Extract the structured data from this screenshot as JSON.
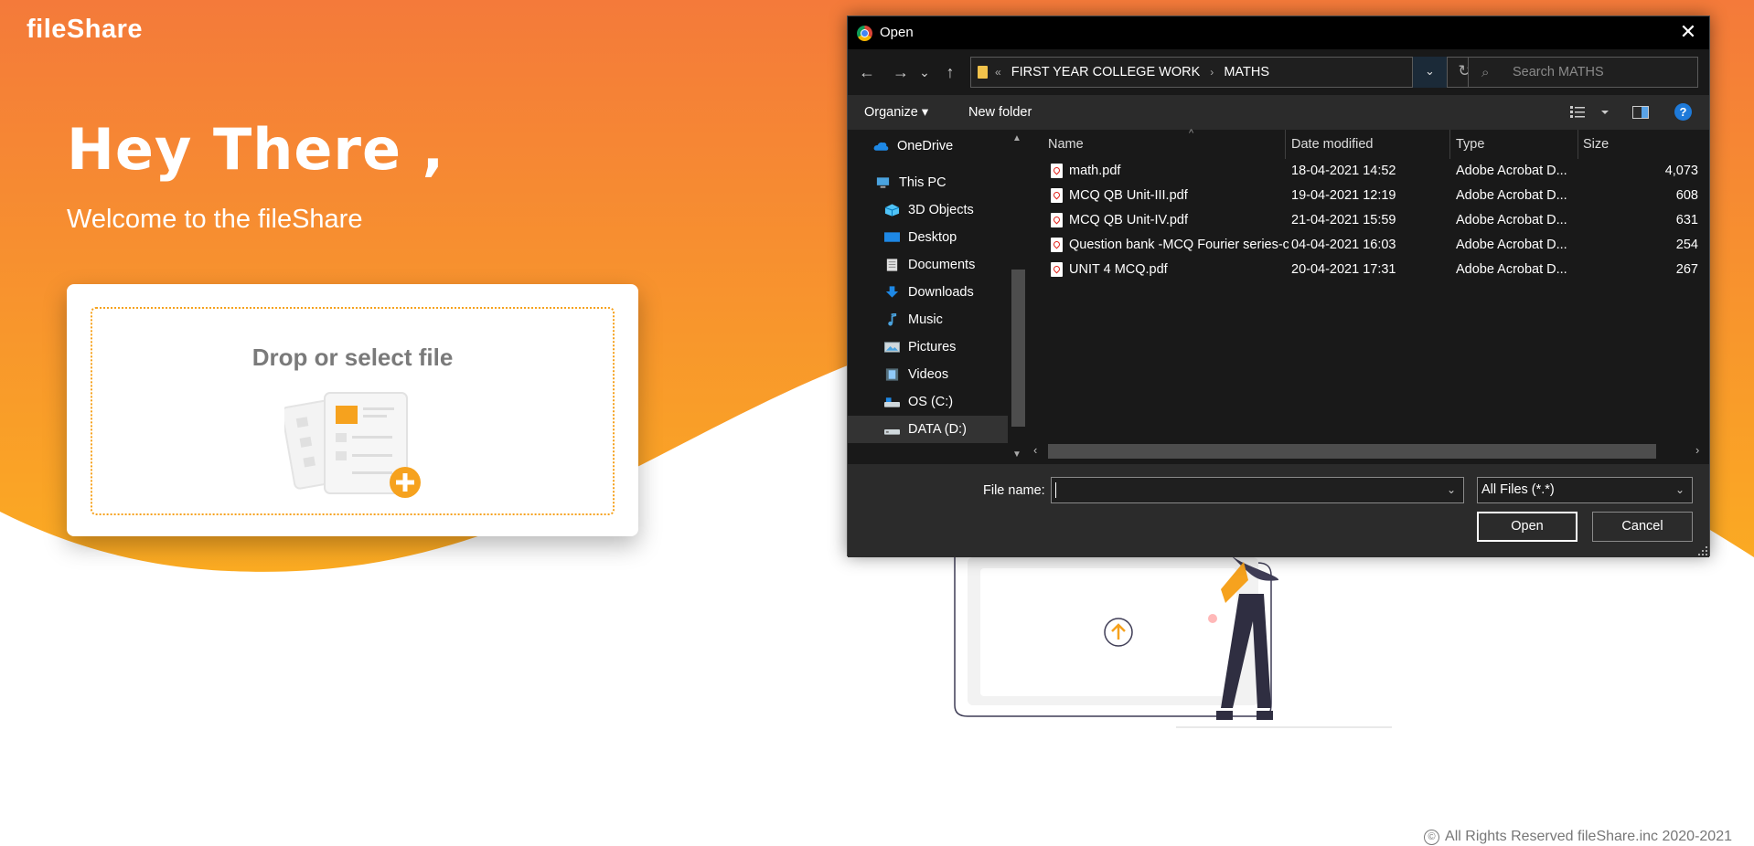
{
  "brand": {
    "name": "fileShare"
  },
  "hero": {
    "title": "Hey There ,",
    "subtitle": "Welcome to the fileShare"
  },
  "upload": {
    "drop_label": "Drop or select file"
  },
  "footer": {
    "copyright_symbol": "©",
    "text": "All Rights Reserved fileShare.inc 2020-2021"
  },
  "colors": {
    "orange_top": "#f47a3a",
    "orange_bottom": "#fbab22",
    "accent": "#f6a21e",
    "dialog_bg": "#2b2b2b",
    "dialog_dark": "#191919"
  },
  "dialog": {
    "title": "Open",
    "close_glyph": "✕",
    "nav": {
      "back": "←",
      "forward": "→",
      "recent": "⌄",
      "up": "↑"
    },
    "address": {
      "overflow": "«",
      "crumbs": [
        "FIRST YEAR COLLEGE WORK",
        "MATHS"
      ],
      "separator": "›"
    },
    "search": {
      "placeholder": "Search MATHS"
    },
    "toolbar": {
      "organize": "Organize ▾",
      "new_folder": "New folder",
      "help": "?"
    },
    "sidebar": [
      {
        "label": "OneDrive",
        "icon": "onedrive-icon"
      },
      {
        "label": "This PC",
        "icon": "computer-icon"
      },
      {
        "label": "3D Objects",
        "icon": "cube-icon"
      },
      {
        "label": "Desktop",
        "icon": "desktop-icon"
      },
      {
        "label": "Documents",
        "icon": "documents-icon"
      },
      {
        "label": "Downloads",
        "icon": "download-icon"
      },
      {
        "label": "Music",
        "icon": "music-icon"
      },
      {
        "label": "Pictures",
        "icon": "pictures-icon"
      },
      {
        "label": "Videos",
        "icon": "videos-icon"
      },
      {
        "label": "OS (C:)",
        "icon": "drive-icon"
      },
      {
        "label": "DATA (D:)",
        "icon": "drive-icon",
        "selected": true
      }
    ],
    "columns": {
      "name": "Name",
      "date": "Date modified",
      "type": "Type",
      "size": "Size"
    },
    "files": [
      {
        "name": "math.pdf",
        "date": "18-04-2021 14:52",
        "type": "Adobe Acrobat D...",
        "size": "4,073"
      },
      {
        "name": "MCQ QB Unit-III.pdf",
        "date": "19-04-2021 12:19",
        "type": "Adobe Acrobat D...",
        "size": "608"
      },
      {
        "name": "MCQ QB Unit-IV.pdf",
        "date": "21-04-2021 15:59",
        "type": "Adobe Acrobat D...",
        "size": "631"
      },
      {
        "name": "Question bank -MCQ Fourier series-conv...",
        "date": "04-04-2021 16:03",
        "type": "Adobe Acrobat D...",
        "size": "254"
      },
      {
        "name": "UNIT 4 MCQ.pdf",
        "date": "20-04-2021 17:31",
        "type": "Adobe Acrobat D...",
        "size": "267"
      }
    ],
    "filename": {
      "label": "File name:",
      "value": ""
    },
    "filetype": {
      "value": "All Files (*.*)"
    },
    "buttons": {
      "open": "Open",
      "cancel": "Cancel"
    }
  }
}
